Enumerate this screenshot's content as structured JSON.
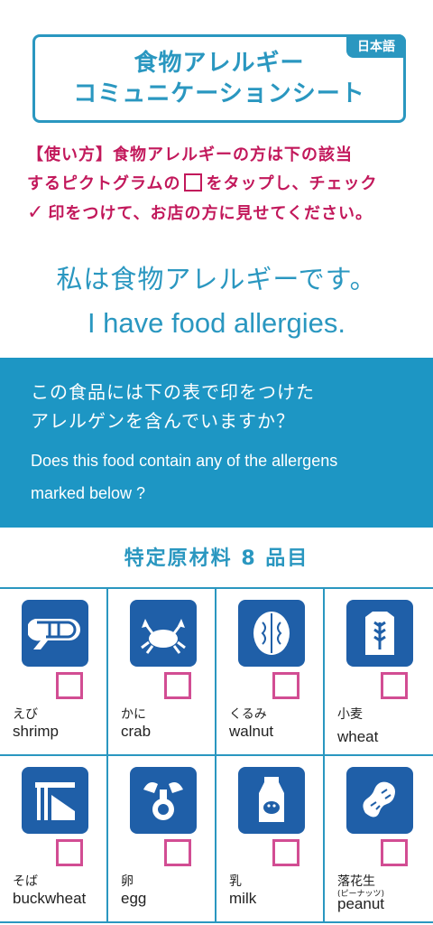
{
  "header": {
    "lang_badge": "日本語",
    "title_line1": "食物アレルギー",
    "title_line2": "コミュニケーションシート"
  },
  "instructions": {
    "line1": "【使い方】食物アレルギーの方は下の該当",
    "line2a": "するピクトグラムの",
    "line2b": "をタップし、チェック",
    "check_glyph": "✓",
    "line3": "印をつけて、お店の方に見せてください。"
  },
  "statement": {
    "jp": "私は食物アレルギーです。",
    "en": "I have food allergies."
  },
  "question": {
    "jp_line1": "この食品には下の表で印をつけた",
    "jp_line2": "アレルゲンを含んでいますか？",
    "en_line1": "Does this food contain any of  the allergens",
    "en_line2": "marked below ?"
  },
  "section_title": "特定原材料 8 品目",
  "colors": {
    "accent": "#2a97c0",
    "band": "#1d96c4",
    "tile": "#1f5fa8",
    "check": "#d24d93",
    "howto": "#c2185b"
  },
  "allergens": [
    {
      "icon": "shrimp-icon",
      "jp": "えび",
      "en": "shrimp",
      "checked": false
    },
    {
      "icon": "crab-icon",
      "jp": "かに",
      "en": "crab",
      "checked": false
    },
    {
      "icon": "walnut-icon",
      "jp": "くるみ",
      "en": "walnut",
      "checked": false
    },
    {
      "icon": "wheat-icon",
      "jp": "小麦",
      "en": "wheat",
      "checked": false
    },
    {
      "icon": "buckwheat-icon",
      "jp": "そば",
      "en": "buckwheat",
      "checked": false
    },
    {
      "icon": "egg-icon",
      "jp": "卵",
      "en": "egg",
      "checked": false
    },
    {
      "icon": "milk-icon",
      "jp": "乳",
      "en": "milk",
      "checked": false
    },
    {
      "icon": "peanut-icon",
      "jp": "落花生",
      "sub": "(ピーナッツ)",
      "en": "peanut",
      "checked": false
    }
  ]
}
